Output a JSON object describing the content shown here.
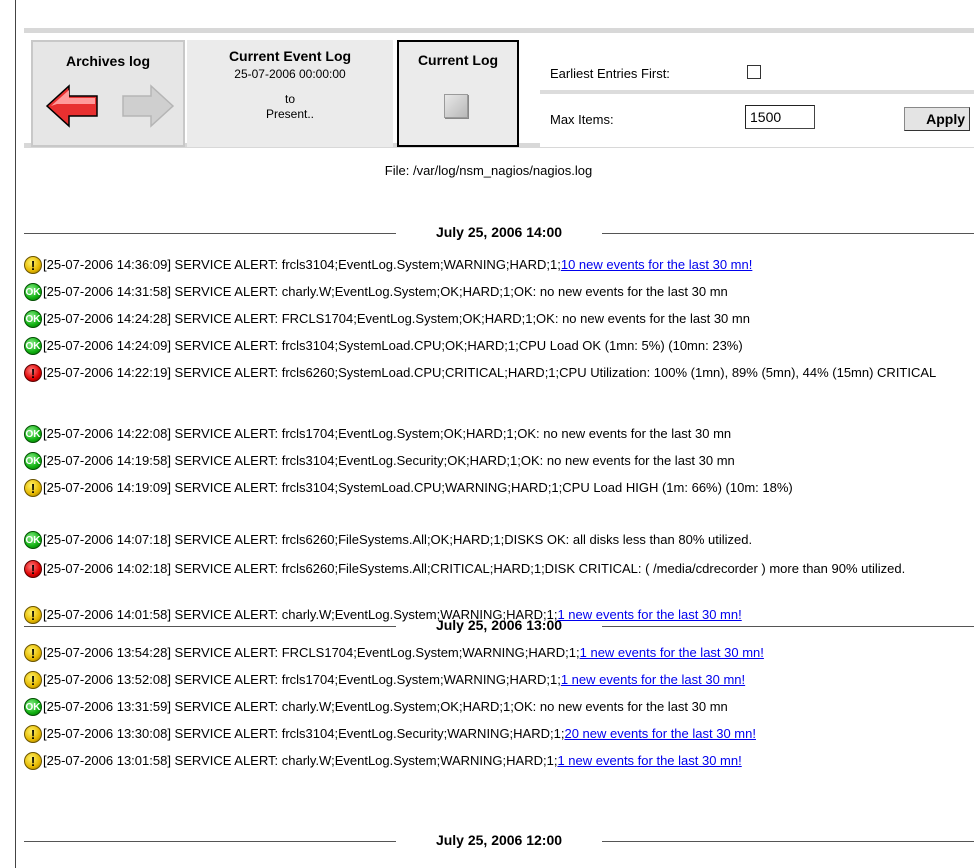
{
  "nav": {
    "archives_title": "Archives log",
    "current_event_title": "Current Event Log",
    "current_event_date": "25-07-2006 00:00:00",
    "current_event_to": "to",
    "current_event_present": "Present..",
    "current_log_title": "Current Log"
  },
  "options": {
    "earliest_label": "Earliest Entries First:",
    "earliest_checked": false,
    "max_items_label": "Max Items:",
    "max_items_value": "1500",
    "apply_label": "Apply"
  },
  "file_line": "File: /var/log/nsm_nagios/nagios.log",
  "hours": [
    "July 25, 2006 14:00",
    "July 25, 2006 13:00",
    "July 25, 2006 12:00"
  ],
  "entries": [
    {
      "status": "warning",
      "text": "[25-07-2006 14:36:09] SERVICE ALERT: frcls3104;EventLog.System;WARNING;HARD;1;",
      "link": "10 new events for the last 30 mn!"
    },
    {
      "status": "ok",
      "text": "[25-07-2006 14:31:58] SERVICE ALERT: charly.W;EventLog.System;OK;HARD;1;OK: no new events for the last 30 mn",
      "link": ""
    },
    {
      "status": "ok",
      "text": "[25-07-2006 14:24:28] SERVICE ALERT: FRCLS1704;EventLog.System;OK;HARD;1;OK: no new events for the last 30 mn",
      "link": ""
    },
    {
      "status": "ok",
      "text": "[25-07-2006 14:24:09] SERVICE ALERT: frcls3104;SystemLoad.CPU;OK;HARD;1;CPU Load OK (1mn: 5%) (10mn: 23%)",
      "link": ""
    },
    {
      "status": "critical",
      "text": "[25-07-2006 14:22:19] SERVICE ALERT: frcls6260;SystemLoad.CPU;CRITICAL;HARD;1;CPU Utilization: 100% (1mn), 89% (5mn), 44% (15mn) CRITICAL",
      "link": ""
    },
    {
      "status": "ok",
      "text": "[25-07-2006 14:22:08] SERVICE ALERT: frcls1704;EventLog.System;OK;HARD;1;OK: no new events for the last 30 mn",
      "link": ""
    },
    {
      "status": "ok",
      "text": "[25-07-2006 14:19:58] SERVICE ALERT: frcls3104;EventLog.Security;OK;HARD;1;OK: no new events for the last 30 mn",
      "link": ""
    },
    {
      "status": "warning",
      "text": "[25-07-2006 14:19:09] SERVICE ALERT: frcls3104;SystemLoad.CPU;WARNING;HARD;1;CPU Load HIGH (1m: 66%) (10m: 18%)",
      "link": ""
    },
    {
      "status": "ok",
      "text": "[25-07-2006 14:07:18] SERVICE ALERT: frcls6260;FileSystems.All;OK;HARD;1;DISKS OK: all disks less than 80% utilized.",
      "link": ""
    },
    {
      "status": "critical",
      "text": "[25-07-2006 14:02:18] SERVICE ALERT: frcls6260;FileSystems.All;CRITICAL;HARD;1;DISK CRITICAL: ( /media/cdrecorder ) more than 90% utilized.",
      "link": ""
    },
    {
      "status": "warning",
      "text": "[25-07-2006 14:01:58] SERVICE ALERT: charly.W;EventLog.System;WARNING;HARD;1;",
      "link": "1 new events for the last 30 mn!"
    },
    {
      "status": "warning",
      "text": "[25-07-2006 13:54:28] SERVICE ALERT: FRCLS1704;EventLog.System;WARNING;HARD;1;",
      "link": "1 new events for the last 30 mn!"
    },
    {
      "status": "warning",
      "text": "[25-07-2006 13:52:08] SERVICE ALERT: frcls1704;EventLog.System;WARNING;HARD;1;",
      "link": "1 new events for the last 30 mn!"
    },
    {
      "status": "ok",
      "text": "[25-07-2006 13:31:59] SERVICE ALERT: charly.W;EventLog.System;OK;HARD;1;OK: no new events for the last 30 mn",
      "link": ""
    },
    {
      "status": "warning",
      "text": "[25-07-2006 13:30:08] SERVICE ALERT: frcls3104;EventLog.Security;WARNING;HARD;1;",
      "link": "20 new events for the last 30 mn!"
    },
    {
      "status": "warning",
      "text": "[25-07-2006 13:01:58] SERVICE ALERT: charly.W;EventLog.System;WARNING;HARD;1;",
      "link": "1 new events for the last 30 mn!"
    }
  ],
  "icon_glyphs": {
    "warning": "!",
    "ok": "OK",
    "critical": "!"
  },
  "colors": {
    "link": "#0000ee",
    "ok": "#10b010",
    "warning": "#e6b800",
    "critical": "#e00000",
    "back_arrow": "#e83030"
  }
}
